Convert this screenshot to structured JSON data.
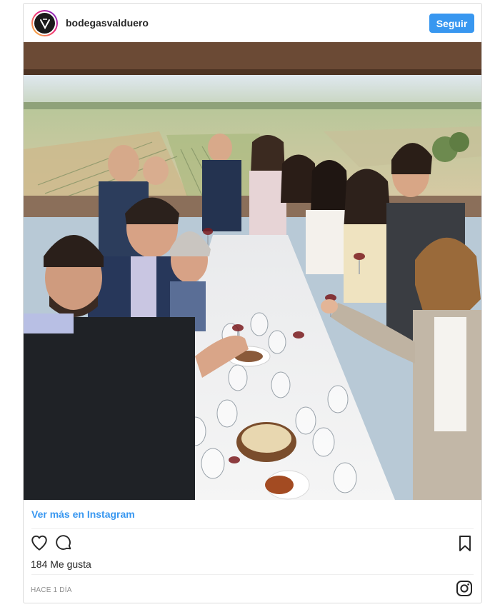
{
  "post": {
    "username": "bodegasvalduero",
    "follow_label": "Seguir",
    "view_more_label": "Ver más en Instagram",
    "likes_text": "184 Me gusta",
    "timestamp": "HACE 1 DÍA"
  },
  "icons": {
    "avatar": "bodega-logo-icon",
    "like": "heart-icon",
    "comment": "comment-icon",
    "save": "bookmark-icon",
    "brand": "instagram-icon"
  },
  "colors": {
    "follow_button": "#3897f0",
    "link": "#3897f0",
    "text": "#262626",
    "muted": "#8e8e8e",
    "border": "#dbdbdb"
  }
}
